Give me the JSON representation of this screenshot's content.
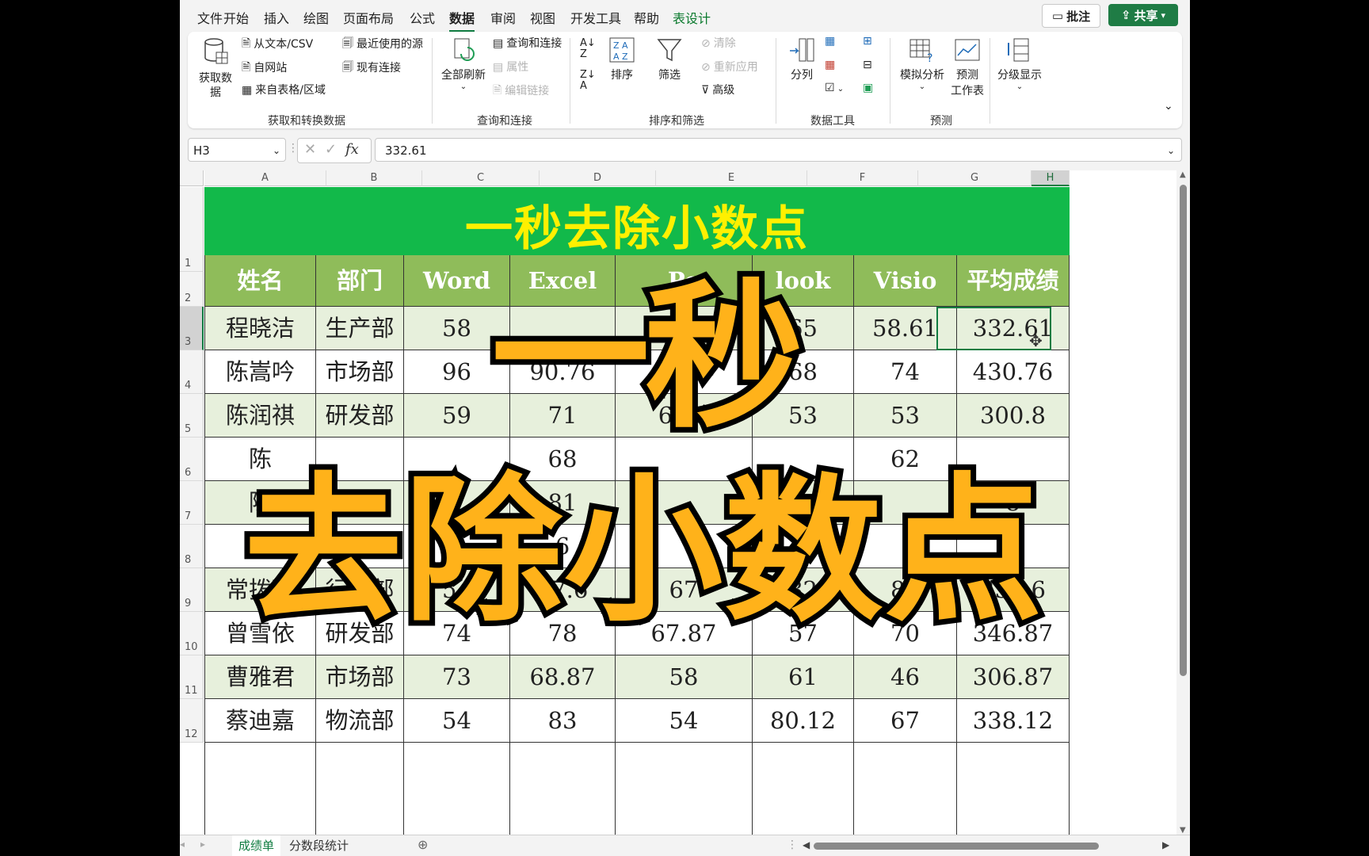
{
  "menu": {
    "items": [
      "文件",
      "开始",
      "插入",
      "绘图",
      "页面布局",
      "公式",
      "数据",
      "审阅",
      "视图",
      "开发工具",
      "帮助",
      "表设计"
    ],
    "active": "数据",
    "comment_label": "批注",
    "share_label": "共享"
  },
  "ribbon": {
    "get_data": "获取数",
    "get_data2": "据",
    "from_text": "从文本/CSV",
    "from_web": "自网站",
    "from_table": "来自表格/区域",
    "recent_sources": "最近使用的源",
    "existing_conn": "现有连接",
    "group_get": "获取和转换数据",
    "refresh_all": "全部刷新",
    "queries_conn": "查询和连接",
    "properties": "属性",
    "edit_links": "编辑链接",
    "group_query": "查询和连接",
    "sort": "排序",
    "filter": "筛选",
    "clear": "清除",
    "reapply": "重新应用",
    "advanced": "高级",
    "group_sort": "排序和筛选",
    "text_to_cols": "分列",
    "group_tools": "数据工具",
    "whatif": "模拟分析",
    "forecast": "预测",
    "forecast2": "工作表",
    "group_forecast": "预测",
    "outline": "分级显示"
  },
  "formula_bar": {
    "name_box": "H3",
    "formula": "332.61"
  },
  "columns": [
    "A",
    "B",
    "C",
    "D",
    "E",
    "F",
    "G",
    "H"
  ],
  "rows": [
    "1",
    "2",
    "3",
    "4",
    "5",
    "6",
    "7",
    "8",
    "9",
    "10",
    "11",
    "12"
  ],
  "sheet_title": "一秒去除小数点",
  "table": {
    "headers": [
      "姓名",
      "部门",
      "Word",
      "Excel",
      "Po",
      "look",
      "Visio",
      "平均成绩"
    ],
    "data": [
      [
        "程晓洁",
        "生产部",
        "58",
        "",
        "",
        "65",
        "58.61",
        "332.61"
      ],
      [
        "陈嵩吟",
        "市场部",
        "96",
        "90.76",
        "",
        "68",
        "74",
        "430.76"
      ],
      [
        "陈润祺",
        "研发部",
        "59",
        "71",
        "64.8",
        "53",
        "53",
        "300.8"
      ],
      [
        "陈",
        "",
        "",
        "68",
        "",
        "",
        "62",
        ""
      ],
      [
        "陈",
        "",
        "",
        "81",
        "",
        "",
        "",
        "8"
      ],
      [
        "陈",
        "",
        "",
        "6",
        "",
        "",
        "",
        "5"
      ],
      [
        "常拨琪",
        "行政部",
        "54",
        "67.6",
        "67",
        "82",
        "80",
        "350.6"
      ],
      [
        "曾雪依",
        "研发部",
        "74",
        "78",
        "67.87",
        "57",
        "70",
        "346.87"
      ],
      [
        "曹雅君",
        "市场部",
        "73",
        "68.87",
        "58",
        "61",
        "46",
        "306.87"
      ],
      [
        "蔡迪嘉",
        "物流部",
        "54",
        "83",
        "54",
        "80.12",
        "67",
        "338.12"
      ]
    ]
  },
  "sheet_tabs": [
    "成绩单",
    "分数段统计"
  ],
  "overlay": {
    "line1": "一秒",
    "line2": "去除小数点"
  },
  "colors": {
    "title_bg": "#12b94a",
    "title_text": "#fff000",
    "header_bg": "#8fbc5a",
    "band": "#e7f0dc",
    "overlay": "#ffb21a"
  }
}
